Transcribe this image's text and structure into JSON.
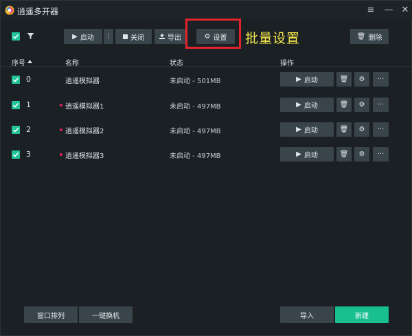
{
  "window": {
    "title": "逍遥多开器"
  },
  "toolbar": {
    "start_label": "启动",
    "close_label": "关闭",
    "export_label": "导出",
    "settings_label": "设置",
    "delete_label": "删除"
  },
  "annotation": {
    "text": "批量设置",
    "highlight_color": "#e3242b",
    "text_color": "#f5e94a"
  },
  "table": {
    "headers": {
      "no": "序号",
      "name": "名称",
      "status": "状态",
      "ops": "操作"
    },
    "rows": [
      {
        "no": "0",
        "name": "逍遥模拟器",
        "status": "未启动 - 501MB",
        "start_label": "启动",
        "dot": false
      },
      {
        "no": "1",
        "name": "逍遥模拟器1",
        "status": "未启动 - 497MB",
        "start_label": "启动",
        "dot": true
      },
      {
        "no": "2",
        "name": "逍遥模拟器2",
        "status": "未启动 - 497MB",
        "start_label": "启动",
        "dot": true
      },
      {
        "no": "3",
        "name": "逍遥模拟器3",
        "status": "未启动 - 497MB",
        "start_label": "启动",
        "dot": true
      }
    ]
  },
  "footer": {
    "arrange_label": "窗口排列",
    "switch_label": "一键换机",
    "import_label": "导入",
    "new_label": "新建"
  },
  "colors": {
    "accent": "#18c08f",
    "background": "#1b2024",
    "button": "#3a444b",
    "dot": "#e0245e"
  }
}
